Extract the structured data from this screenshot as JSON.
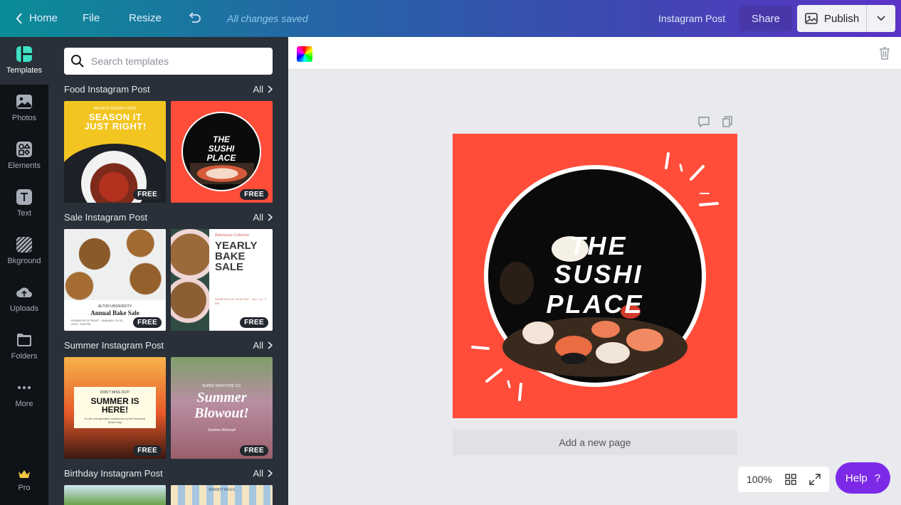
{
  "topbar": {
    "home_label": "Home",
    "file_label": "File",
    "resize_label": "Resize",
    "saved_status": "All changes saved",
    "doc_type": "Instagram Post",
    "share_label": "Share",
    "publish_label": "Publish"
  },
  "rail": {
    "items": [
      {
        "label": "Templates",
        "icon": "templates-icon"
      },
      {
        "label": "Photos",
        "icon": "photos-icon"
      },
      {
        "label": "Elements",
        "icon": "elements-icon"
      },
      {
        "label": "Text",
        "icon": "text-icon"
      },
      {
        "label": "Bkground",
        "icon": "background-icon"
      },
      {
        "label": "Uploads",
        "icon": "uploads-icon"
      },
      {
        "label": "Folders",
        "icon": "folders-icon"
      },
      {
        "label": "More",
        "icon": "more-icon"
      },
      {
        "label": "Pro",
        "icon": "crown-icon"
      }
    ]
  },
  "panel": {
    "search_placeholder": "Search templates",
    "sections": [
      {
        "title": "Food Instagram Post",
        "all": "All"
      },
      {
        "title": "Sale Instagram Post",
        "all": "All"
      },
      {
        "title": "Summer Instagram Post",
        "all": "All"
      },
      {
        "title": "Birthday Instagram Post",
        "all": "All"
      }
    ],
    "free_label": "FREE",
    "thumbs": {
      "food1_small": "BRUNCH SUNDAY FOOD",
      "food1_title": "SEASON IT JUST RIGHT!",
      "food2_title": "THE SUSHI PLACE",
      "sale1_small": "ALTON UNIVERSITY",
      "sale1_title": "Annual Bake Sale",
      "sale1_sub": "DRINKS BY A TREAT · JANUARY 22-24, 2019 · 5:00 PM",
      "sale2_small": "Bakehouse Collective",
      "sale2_title": "YEARLY BAKE SALE",
      "sale2_sub": "SWEETEN UP YOUR DAY · JULY 12 · 3 PM",
      "summer1_small": "DON'T MISS OUT!",
      "summer1_title": "SUMMER IS HERE!",
      "summer1_sub": "Exotic unforgettable experience at the Redwood Beach Bay",
      "summer2_small": "SUPER SMOOTHIE CO.",
      "summer2_title": "Summer Blowout!",
      "summer2_sub": "Summer Blowout!",
      "bday2_small": "BRANDT MILES"
    }
  },
  "canvas": {
    "design_title": "THE SUSHI PLACE",
    "add_page_label": "Add a new page",
    "zoom": "100%",
    "help_label": "Help",
    "help_mark": "?"
  },
  "colors": {
    "accent_purple": "#7d2ae8",
    "design_red": "#ff4d3a",
    "panel_bg": "#293039",
    "rail_bg": "#0f1217"
  }
}
